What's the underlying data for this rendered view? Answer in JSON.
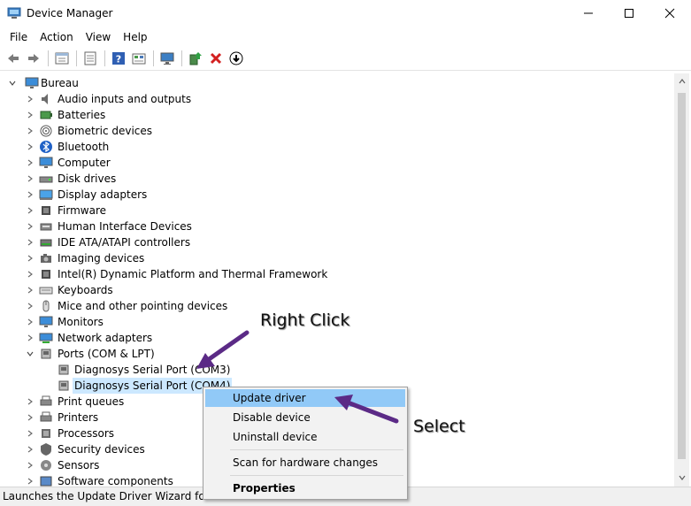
{
  "window": {
    "title": "Device Manager",
    "controls": [
      "minimize",
      "maximize",
      "close"
    ]
  },
  "menu": [
    "File",
    "Action",
    "View",
    "Help"
  ],
  "toolbar": [
    "back-icon",
    "forward-icon",
    "properties-view-icon",
    "details-icon",
    "help-icon",
    "driver-icon",
    "monitor-icon",
    "add-driver-icon",
    "uninstall-icon",
    "download-icon"
  ],
  "tree": {
    "root": "Bureau",
    "items": [
      {
        "label": "Audio inputs and outputs",
        "icon": "speaker-icon"
      },
      {
        "label": "Batteries",
        "icon": "battery-icon"
      },
      {
        "label": "Biometric devices",
        "icon": "fingerprint-icon"
      },
      {
        "label": "Bluetooth",
        "icon": "bluetooth-icon"
      },
      {
        "label": "Computer",
        "icon": "computer-icon"
      },
      {
        "label": "Disk drives",
        "icon": "disk-icon"
      },
      {
        "label": "Display adapters",
        "icon": "display-adapter-icon"
      },
      {
        "label": "Firmware",
        "icon": "chip-icon"
      },
      {
        "label": "Human Interface Devices",
        "icon": "hid-icon"
      },
      {
        "label": "IDE ATA/ATAPI controllers",
        "icon": "ide-icon"
      },
      {
        "label": "Imaging devices",
        "icon": "camera-icon"
      },
      {
        "label": "Intel(R) Dynamic Platform and Thermal Framework",
        "icon": "chip-icon"
      },
      {
        "label": "Keyboards",
        "icon": "keyboard-icon"
      },
      {
        "label": "Mice and other pointing devices",
        "icon": "mouse-icon"
      },
      {
        "label": "Monitors",
        "icon": "monitor-icon"
      },
      {
        "label": "Network adapters",
        "icon": "network-icon"
      },
      {
        "label": "Ports (COM & LPT)",
        "icon": "port-icon",
        "expanded": true
      },
      {
        "label": "Diagnosys Serial Port (COM3)",
        "icon": "port-icon",
        "child": true
      },
      {
        "label": "Diagnosys Serial Port (COM4)",
        "icon": "port-icon",
        "child": true,
        "selected": true
      },
      {
        "label": "Print queues",
        "icon": "printer-icon"
      },
      {
        "label": "Printers",
        "icon": "printer-icon"
      },
      {
        "label": "Processors",
        "icon": "processor-icon"
      },
      {
        "label": "Security devices",
        "icon": "security-icon"
      },
      {
        "label": "Sensors",
        "icon": "sensor-icon"
      },
      {
        "label": "Software components",
        "icon": "software-icon"
      }
    ]
  },
  "context_menu": {
    "items": [
      "Update driver",
      "Disable device",
      "Uninstall device",
      "Scan for hardware changes",
      "Properties"
    ]
  },
  "annotations": {
    "right_click": "Right Click",
    "select": "Select"
  },
  "status": "Launches the Update Driver Wizard for the",
  "colors": {
    "selection": "#cce8ff",
    "menu_highlight": "#91c9f7",
    "arrow": "#5b2a86"
  }
}
